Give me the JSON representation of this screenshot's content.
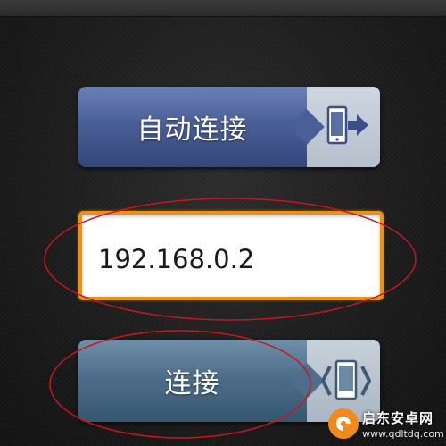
{
  "auto_connect": {
    "label": "自动连接",
    "icon": "phone-arrow-icon",
    "color": "#4a5f97"
  },
  "ip_field": {
    "value": "192.168.0.2",
    "border_color": "#f0900a"
  },
  "connect": {
    "label": "连接",
    "icon": "phone-connect-icon",
    "color": "#4e6d8a"
  },
  "watermark": {
    "title": "启东安卓网",
    "url": "www.qdltdq.com"
  }
}
